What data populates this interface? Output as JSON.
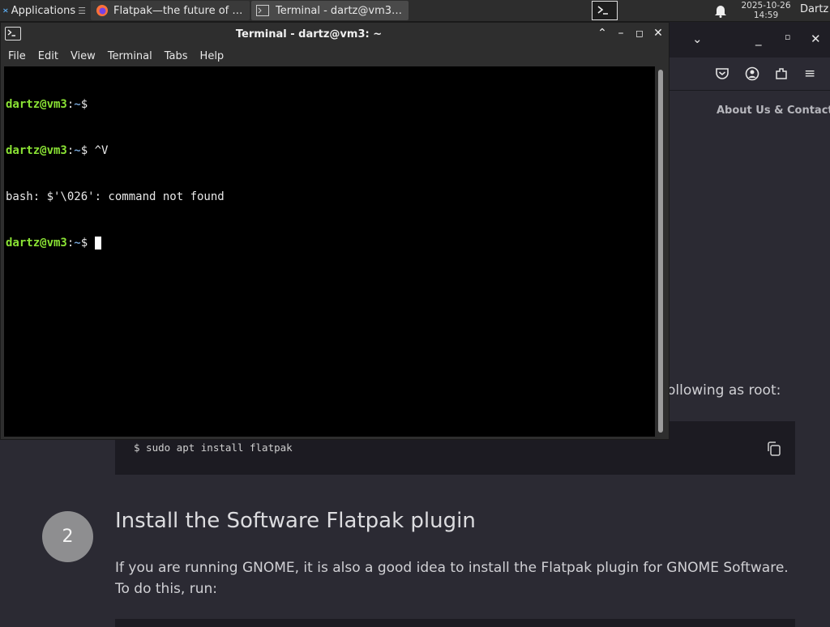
{
  "panel": {
    "apps_label": "Applications",
    "tasks": [
      {
        "label": "Flatpak—the future of a...",
        "icon": "firefox-icon"
      },
      {
        "label": "Terminal - dartz@vm3: ~",
        "icon": "terminal-icon"
      }
    ],
    "clock_date": "2025-10-26",
    "clock_time": "14:59",
    "user": "Dartz"
  },
  "terminal": {
    "title": "Terminal - dartz@vm3: ~",
    "menu": [
      "File",
      "Edit",
      "View",
      "Terminal",
      "Tabs",
      "Help"
    ],
    "lines": [
      {
        "user": "dartz@vm3",
        "sep": ":",
        "path": "~",
        "prompt": "$",
        "cmd": ""
      },
      {
        "user": "dartz@vm3",
        "sep": ":",
        "path": "~",
        "prompt": "$",
        "cmd": " ^V"
      },
      {
        "output": "bash: $'\\026': command not found"
      },
      {
        "user": "dartz@vm3",
        "sep": ":",
        "path": "~",
        "prompt": "$",
        "cmd": " "
      }
    ]
  },
  "browser": {
    "nav_link": "About Us & Contact",
    "root_text": "ollowing as root:",
    "code": "$ sudo apt install flatpak",
    "step_number": "2",
    "step_title": "Install the Software Flatpak plugin",
    "step_desc": "If you are running GNOME, it is also a good idea to install the Flatpak plugin for GNOME Software. To do this, run:"
  },
  "colors": {
    "prompt_user": "#8ae234",
    "prompt_path": "#729fcf",
    "terminal_bg": "#000000",
    "page_bg": "#2b2a33"
  }
}
